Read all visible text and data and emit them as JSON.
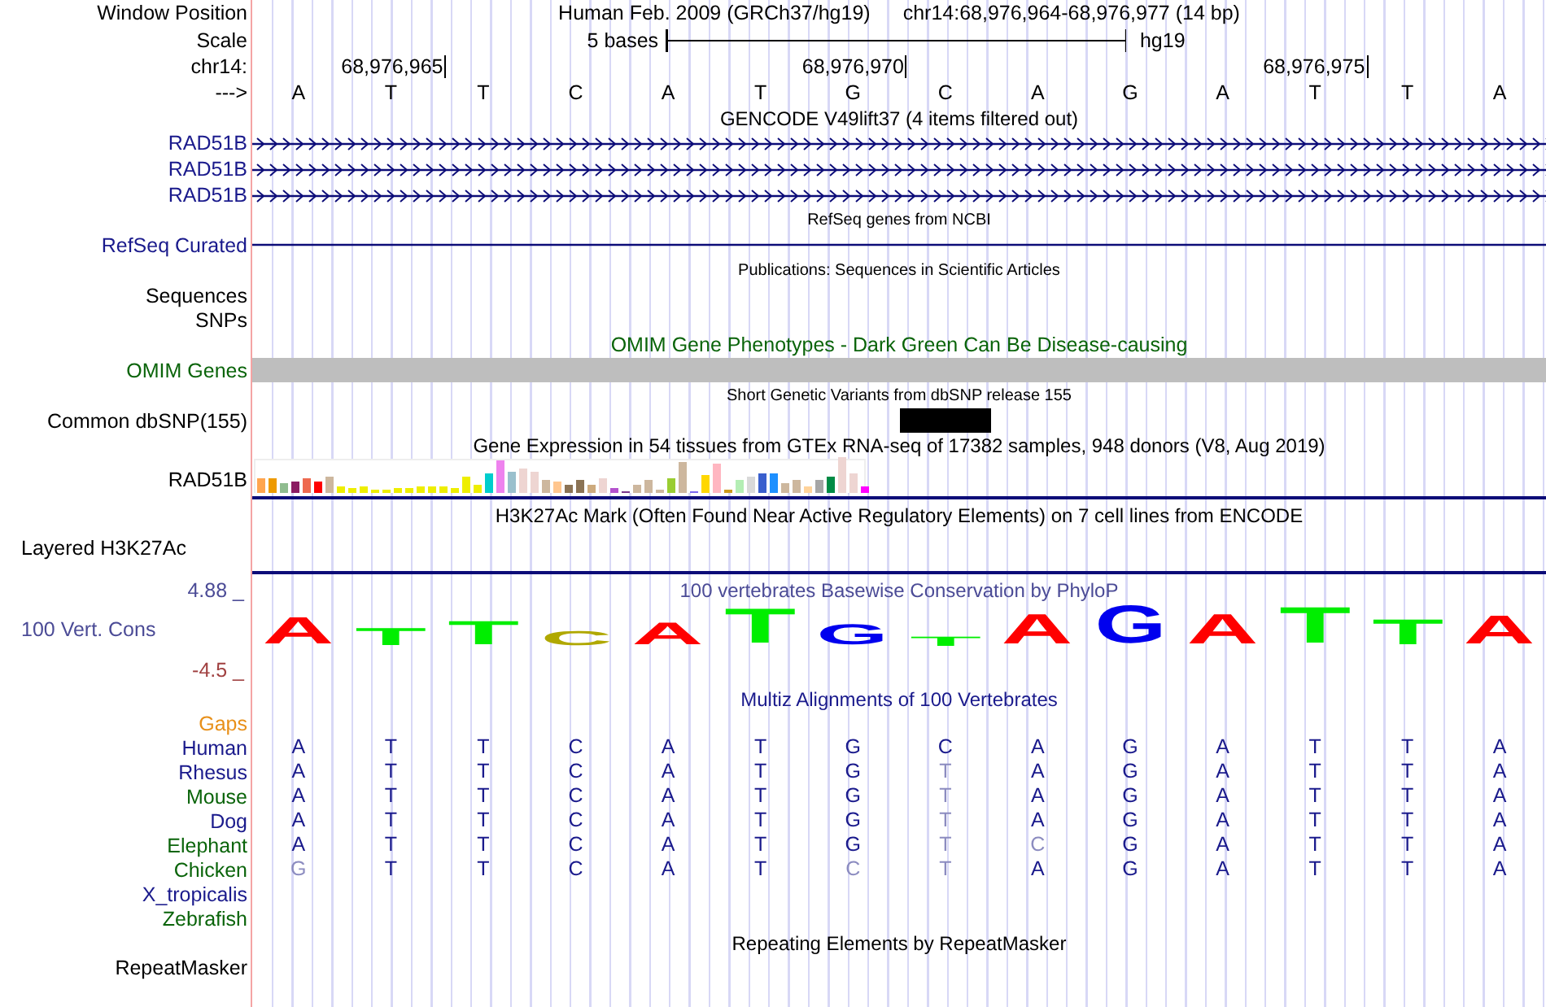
{
  "header": {
    "position_label": "Window Position",
    "assembly": "Human Feb. 2009 (GRCh37/hg19)",
    "position": "chr14:68,976,964-68,976,977 (14 bp)",
    "scale_label": "Scale",
    "scale_length": "5 bases",
    "scale_db": "hg19",
    "chrom_label": "chr14:",
    "ticks": [
      "68,976,965",
      "68,976,970",
      "68,976,975"
    ],
    "strand_label": "--->",
    "bases": [
      "A",
      "T",
      "T",
      "C",
      "A",
      "T",
      "G",
      "C",
      "A",
      "G",
      "A",
      "T",
      "T",
      "A"
    ]
  },
  "tracks": [
    {
      "kind": "genes",
      "title": "GENCODE V49lift37 (4 items filtered out)",
      "rows": [
        {
          "label": "RAD51B",
          "color": "#1a1a8c"
        },
        {
          "label": "RAD51B",
          "color": "#1a1a8c"
        },
        {
          "label": "RAD51B",
          "color": "#1a1a8c"
        }
      ]
    },
    {
      "kind": "refseq",
      "title": "RefSeq genes from NCBI",
      "rows": [
        {
          "label": "RefSeq Curated",
          "color": "#1a1a8c"
        }
      ]
    },
    {
      "kind": "publications",
      "title": "Publications: Sequences in Scientific Articles",
      "rows": [
        {
          "label": "Sequences",
          "color": "#000000"
        },
        {
          "label": "SNPs",
          "color": "#000000"
        }
      ]
    },
    {
      "kind": "omim",
      "title": "OMIM Gene Phenotypes - Dark Green Can Be Disease-causing",
      "rows": [
        {
          "label": "OMIM Genes",
          "color": "#0a640a"
        }
      ]
    },
    {
      "kind": "snp",
      "title": "Short Genetic Variants from dbSNP release 155",
      "rows": [
        {
          "label": "Common dbSNP(155)",
          "color": "#000000"
        }
      ]
    },
    {
      "kind": "expression",
      "title": "Gene Expression in 54 tissues from GTEx RNA-seq of 17382 samples, 948 donors (V8, Aug 2019)",
      "rows": [
        {
          "label": "RAD51B",
          "color": "#000000"
        }
      ]
    },
    {
      "kind": "histone",
      "title": "H3K27Ac Mark (Often Found Near Active Regulatory Elements) on 7 cell lines from ENCODE",
      "rows": [
        {
          "label": "Layered H3K27Ac",
          "color": "#000000"
        }
      ]
    },
    {
      "kind": "conservation",
      "title": "100 vertebrates Basewise Conservation by PhyloP",
      "max_label": "4.88 _",
      "min_label": "-4.5 _",
      "rows": [
        {
          "label": "100 Vert. Cons",
          "color": "#4b4b96"
        }
      ],
      "logo": [
        {
          "base": "A",
          "color": "#ff0000"
        },
        {
          "base": "T",
          "color": "#00ee00"
        },
        {
          "base": "T",
          "color": "#00ee00"
        },
        {
          "base": "C",
          "color": "#b0a800"
        },
        {
          "base": "A",
          "color": "#ff0000"
        },
        {
          "base": "T",
          "color": "#00ee00"
        },
        {
          "base": "G",
          "color": "#0000ee"
        },
        {
          "base": "T",
          "color": "#00ee00"
        },
        {
          "base": "A",
          "color": "#ff0000"
        },
        {
          "base": "G",
          "color": "#0000ee"
        },
        {
          "base": "A",
          "color": "#ff0000"
        },
        {
          "base": "T",
          "color": "#00ee00"
        },
        {
          "base": "T",
          "color": "#00ee00"
        },
        {
          "base": "A",
          "color": "#ff0000"
        }
      ]
    },
    {
      "kind": "alignment",
      "title": "Multiz Alignments of 100 Vertebrates",
      "rows": [
        {
          "label": "Gaps",
          "color": "#e8901a"
        },
        {
          "label": "Human",
          "color": "#1a1a8c",
          "bases": [
            {
              "b": "A",
              "faded": false
            },
            {
              "b": "T",
              "faded": false
            },
            {
              "b": "T",
              "faded": false
            },
            {
              "b": "C",
              "faded": false
            },
            {
              "b": "A",
              "faded": false
            },
            {
              "b": "T",
              "faded": false
            },
            {
              "b": "G",
              "faded": false
            },
            {
              "b": "C",
              "faded": false
            },
            {
              "b": "A",
              "faded": false
            },
            {
              "b": "G",
              "faded": false
            },
            {
              "b": "A",
              "faded": false
            },
            {
              "b": "T",
              "faded": false
            },
            {
              "b": "T",
              "faded": false
            },
            {
              "b": "A",
              "faded": false
            }
          ]
        },
        {
          "label": "Rhesus",
          "color": "#1a1a8c",
          "bases": [
            {
              "b": "A",
              "faded": false
            },
            {
              "b": "T",
              "faded": false
            },
            {
              "b": "T",
              "faded": false
            },
            {
              "b": "C",
              "faded": false
            },
            {
              "b": "A",
              "faded": false
            },
            {
              "b": "T",
              "faded": false
            },
            {
              "b": "G",
              "faded": false
            },
            {
              "b": "T",
              "faded": true
            },
            {
              "b": "A",
              "faded": false
            },
            {
              "b": "G",
              "faded": false
            },
            {
              "b": "A",
              "faded": false
            },
            {
              "b": "T",
              "faded": false
            },
            {
              "b": "T",
              "faded": false
            },
            {
              "b": "A",
              "faded": false
            }
          ]
        },
        {
          "label": "Mouse",
          "color": "#0a640a",
          "bases": [
            {
              "b": "A",
              "faded": false
            },
            {
              "b": "T",
              "faded": false
            },
            {
              "b": "T",
              "faded": false
            },
            {
              "b": "C",
              "faded": false
            },
            {
              "b": "A",
              "faded": false
            },
            {
              "b": "T",
              "faded": false
            },
            {
              "b": "G",
              "faded": false
            },
            {
              "b": "T",
              "faded": true
            },
            {
              "b": "A",
              "faded": false
            },
            {
              "b": "G",
              "faded": false
            },
            {
              "b": "A",
              "faded": false
            },
            {
              "b": "T",
              "faded": false
            },
            {
              "b": "T",
              "faded": false
            },
            {
              "b": "A",
              "faded": false
            }
          ]
        },
        {
          "label": "Dog",
          "color": "#1a1a8c",
          "bases": [
            {
              "b": "A",
              "faded": false
            },
            {
              "b": "T",
              "faded": false
            },
            {
              "b": "T",
              "faded": false
            },
            {
              "b": "C",
              "faded": false
            },
            {
              "b": "A",
              "faded": false
            },
            {
              "b": "T",
              "faded": false
            },
            {
              "b": "G",
              "faded": false
            },
            {
              "b": "T",
              "faded": true
            },
            {
              "b": "A",
              "faded": false
            },
            {
              "b": "G",
              "faded": false
            },
            {
              "b": "A",
              "faded": false
            },
            {
              "b": "T",
              "faded": false
            },
            {
              "b": "T",
              "faded": false
            },
            {
              "b": "A",
              "faded": false
            }
          ]
        },
        {
          "label": "Elephant",
          "color": "#0a640a",
          "bases": [
            {
              "b": "A",
              "faded": false
            },
            {
              "b": "T",
              "faded": false
            },
            {
              "b": "T",
              "faded": false
            },
            {
              "b": "C",
              "faded": false
            },
            {
              "b": "A",
              "faded": false
            },
            {
              "b": "T",
              "faded": false
            },
            {
              "b": "G",
              "faded": false
            },
            {
              "b": "T",
              "faded": true
            },
            {
              "b": "C",
              "faded": true
            },
            {
              "b": "G",
              "faded": false
            },
            {
              "b": "A",
              "faded": false
            },
            {
              "b": "T",
              "faded": false
            },
            {
              "b": "T",
              "faded": false
            },
            {
              "b": "A",
              "faded": false
            }
          ]
        },
        {
          "label": "Chicken",
          "color": "#0a640a",
          "bases": [
            {
              "b": "G",
              "faded": true
            },
            {
              "b": "T",
              "faded": false
            },
            {
              "b": "T",
              "faded": false
            },
            {
              "b": "C",
              "faded": false
            },
            {
              "b": "A",
              "faded": false
            },
            {
              "b": "T",
              "faded": false
            },
            {
              "b": "C",
              "faded": true
            },
            {
              "b": "T",
              "faded": true
            },
            {
              "b": "A",
              "faded": false
            },
            {
              "b": "G",
              "faded": false
            },
            {
              "b": "A",
              "faded": false
            },
            {
              "b": "T",
              "faded": false
            },
            {
              "b": "T",
              "faded": false
            },
            {
              "b": "A",
              "faded": false
            }
          ]
        },
        {
          "label": "X_tropicalis",
          "color": "#1a1a8c"
        },
        {
          "label": "Zebrafish",
          "color": "#0a640a"
        }
      ]
    },
    {
      "kind": "repeats",
      "title": "Repeating Elements by RepeatMasker",
      "rows": [
        {
          "label": "RepeatMasker",
          "color": "#000000"
        }
      ]
    }
  ]
}
